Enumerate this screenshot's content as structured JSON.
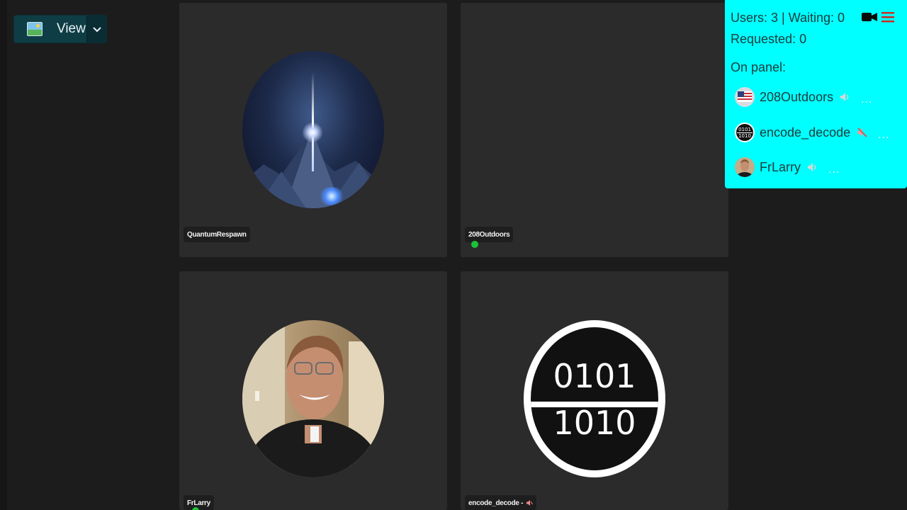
{
  "view_button": {
    "label": "View",
    "icon": "picture-icon",
    "chevron": "chevron-down-icon"
  },
  "tiles": [
    {
      "name": "QuantumRespawn",
      "avatar": "space-art"
    },
    {
      "name": "208Outdoors",
      "avatar": "none",
      "status": "speaking"
    },
    {
      "name": "FrLarry",
      "avatar": "photo"
    },
    {
      "name": "encode_decode -",
      "avatar": "binary"
    }
  ],
  "binary_avatar": {
    "top": "0101",
    "bottom": "1010"
  },
  "panel": {
    "users_line": "Users: 3 | Waiting: 0",
    "requested_line": "Requested: 0",
    "on_panel_label": "On panel:",
    "members": [
      {
        "name": "208Outdoors",
        "audio": "speaker-icon",
        "more": "..."
      },
      {
        "name": "encode_decode",
        "audio": "muted-icon",
        "more": "..."
      },
      {
        "name": "FrLarry",
        "audio": "speaker-icon",
        "more": "..."
      }
    ],
    "accent": "#00ffff"
  },
  "mini_binary": {
    "top": "0101",
    "bottom": "1010"
  }
}
